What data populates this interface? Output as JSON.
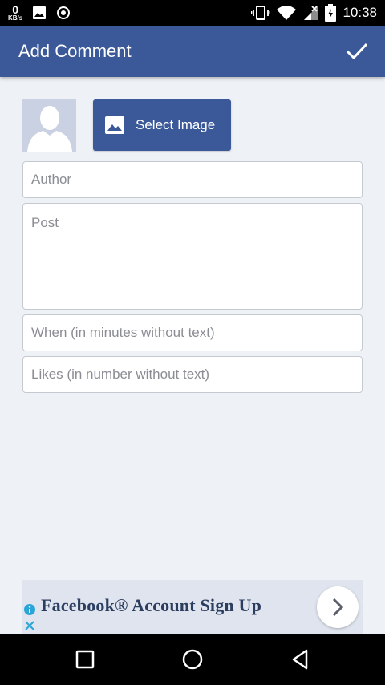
{
  "status_bar": {
    "net_speed_value": "0",
    "net_speed_unit": "KB/s",
    "time": "10:38"
  },
  "app_bar": {
    "title": "Add Comment"
  },
  "form": {
    "select_image_label": "Select Image",
    "author_placeholder": "Author",
    "post_placeholder": "Post",
    "when_placeholder": "When (in minutes without text)",
    "likes_placeholder": "Likes (in number without text)"
  },
  "ad": {
    "text": "Facebook® Account Sign Up"
  },
  "colors": {
    "brand": "#3b5998",
    "background": "#eef1f6"
  },
  "icons": [
    "image-icon",
    "photo-icon",
    "record-icon",
    "vibrate-icon",
    "wifi-icon",
    "signal-icon",
    "battery-icon",
    "check-icon",
    "info-icon",
    "close-icon",
    "chevron-right-icon",
    "recents-icon",
    "home-icon",
    "back-icon"
  ]
}
